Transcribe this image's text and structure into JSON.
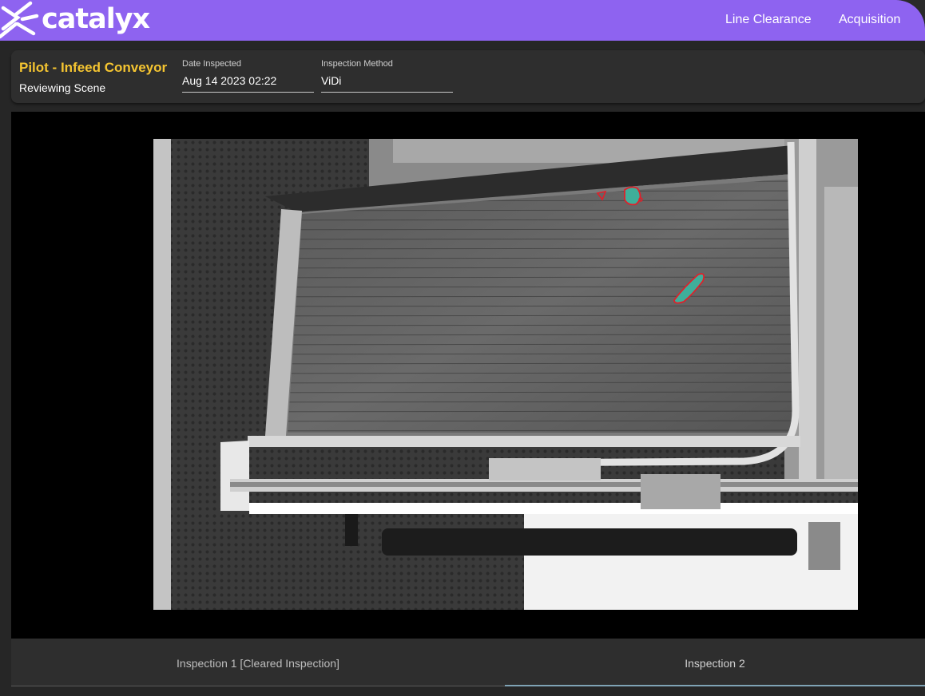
{
  "header": {
    "brand": "catalyx",
    "nav": [
      {
        "label": "Line Clearance"
      },
      {
        "label": "Acquisition"
      }
    ],
    "colors": {
      "bar": "#8e63f0",
      "text": "#ffffff"
    }
  },
  "info": {
    "title": "Pilot - Infeed Conveyor",
    "subtitle": "Reviewing Scene",
    "date_label": "Date Inspected",
    "date_value": "Aug 14 2023 02:22",
    "method_label": "Inspection Method",
    "method_value": "ViDi",
    "colors": {
      "title": "#f5c531"
    }
  },
  "viewer": {
    "image": "grayscale conveyor inspection image",
    "defect_marker_color": "#e0202a",
    "defect_fill_color": "#3fae9a"
  },
  "tabs": [
    {
      "label": "Inspection 1 [Cleared Inspection]",
      "selected": false
    },
    {
      "label": "Inspection 2",
      "selected": true
    }
  ]
}
